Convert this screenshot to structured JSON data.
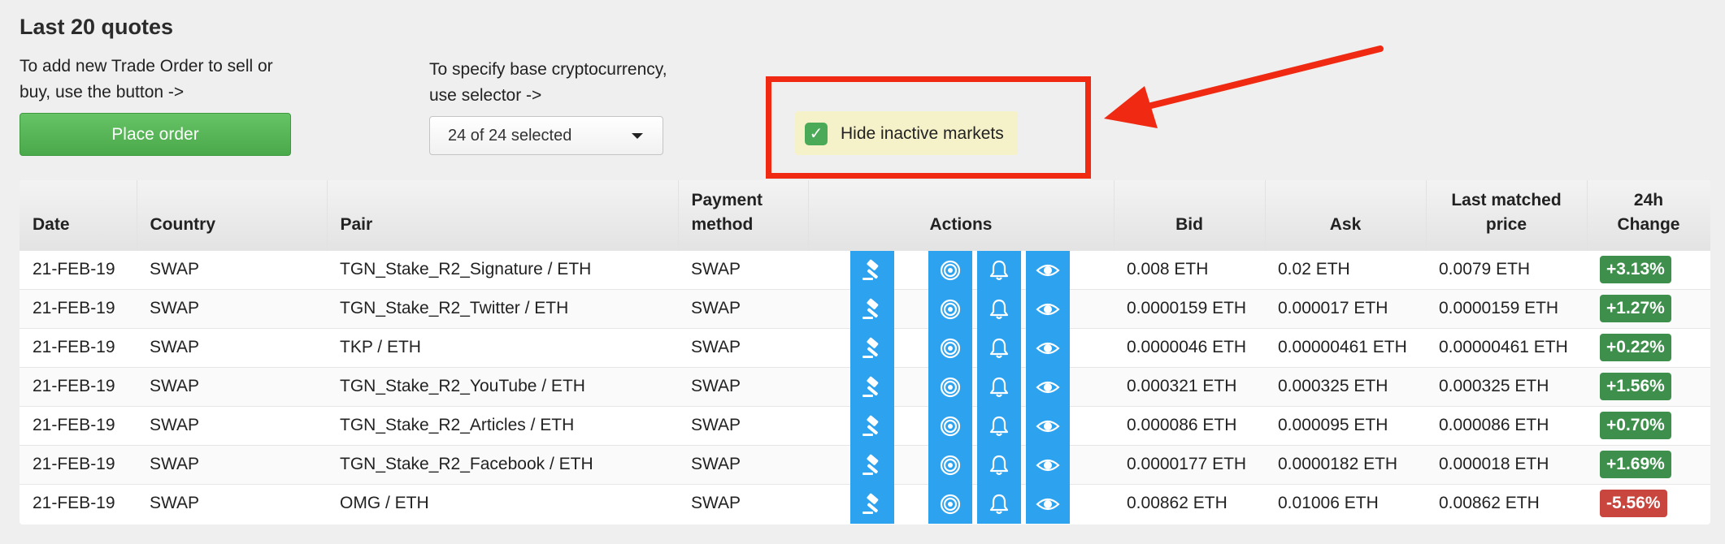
{
  "title": "Last 20 quotes",
  "hints": {
    "trade_order": "To add new Trade Order to sell or buy, use the button ->",
    "selector": "To specify base cryptocurrency, use selector ->"
  },
  "buttons": {
    "place_order": "Place order"
  },
  "selector": {
    "value": "24 of 24 selected"
  },
  "filter": {
    "hide_inactive_label": "Hide inactive markets",
    "checked": true
  },
  "colors": {
    "accent_blue": "#2da3f0",
    "place_order_green": "#4aa94a",
    "highlight_red": "#f02a12",
    "positive": "#3f8f4c",
    "negative": "#c9463f"
  },
  "table": {
    "headers": {
      "date": "Date",
      "country": "Country",
      "pair": "Pair",
      "payment_line1": "Payment",
      "payment_line2": "method",
      "actions": "Actions",
      "bid": "Bid",
      "ask": "Ask",
      "last_line1": "Last matched",
      "last_line2": "price",
      "change_line1": "24h",
      "change_line2": "Change"
    },
    "action_icons": [
      "gavel-icon",
      "target-icon",
      "bell-icon",
      "eye-icon"
    ],
    "rows": [
      {
        "date": "21-FEB-19",
        "country": "SWAP",
        "pair": "TGN_Stake_R2_Signature / ETH",
        "payment": "SWAP",
        "bid": "0.008 ETH",
        "ask": "0.02 ETH",
        "last": "0.0079 ETH",
        "change": "+3.13%",
        "direction": "up"
      },
      {
        "date": "21-FEB-19",
        "country": "SWAP",
        "pair": "TGN_Stake_R2_Twitter / ETH",
        "payment": "SWAP",
        "bid": "0.0000159 ETH",
        "ask": "0.000017 ETH",
        "last": "0.0000159 ETH",
        "change": "+1.27%",
        "direction": "up"
      },
      {
        "date": "21-FEB-19",
        "country": "SWAP",
        "pair": "TKP / ETH",
        "payment": "SWAP",
        "bid": "0.0000046 ETH",
        "ask": "0.00000461 ETH",
        "last": "0.00000461 ETH",
        "change": "+0.22%",
        "direction": "up"
      },
      {
        "date": "21-FEB-19",
        "country": "SWAP",
        "pair": "TGN_Stake_R2_YouTube / ETH",
        "payment": "SWAP",
        "bid": "0.000321 ETH",
        "ask": "0.000325 ETH",
        "last": "0.000325 ETH",
        "change": "+1.56%",
        "direction": "up"
      },
      {
        "date": "21-FEB-19",
        "country": "SWAP",
        "pair": "TGN_Stake_R2_Articles / ETH",
        "payment": "SWAP",
        "bid": "0.000086 ETH",
        "ask": "0.000095 ETH",
        "last": "0.000086 ETH",
        "change": "+0.70%",
        "direction": "up"
      },
      {
        "date": "21-FEB-19",
        "country": "SWAP",
        "pair": "TGN_Stake_R2_Facebook / ETH",
        "payment": "SWAP",
        "bid": "0.0000177 ETH",
        "ask": "0.0000182 ETH",
        "last": "0.000018 ETH",
        "change": "+1.69%",
        "direction": "up"
      },
      {
        "date": "21-FEB-19",
        "country": "SWAP",
        "pair": "OMG / ETH",
        "payment": "SWAP",
        "bid": "0.00862 ETH",
        "ask": "0.01006 ETH",
        "last": "0.00862 ETH",
        "change": "-5.56%",
        "direction": "down"
      }
    ]
  }
}
